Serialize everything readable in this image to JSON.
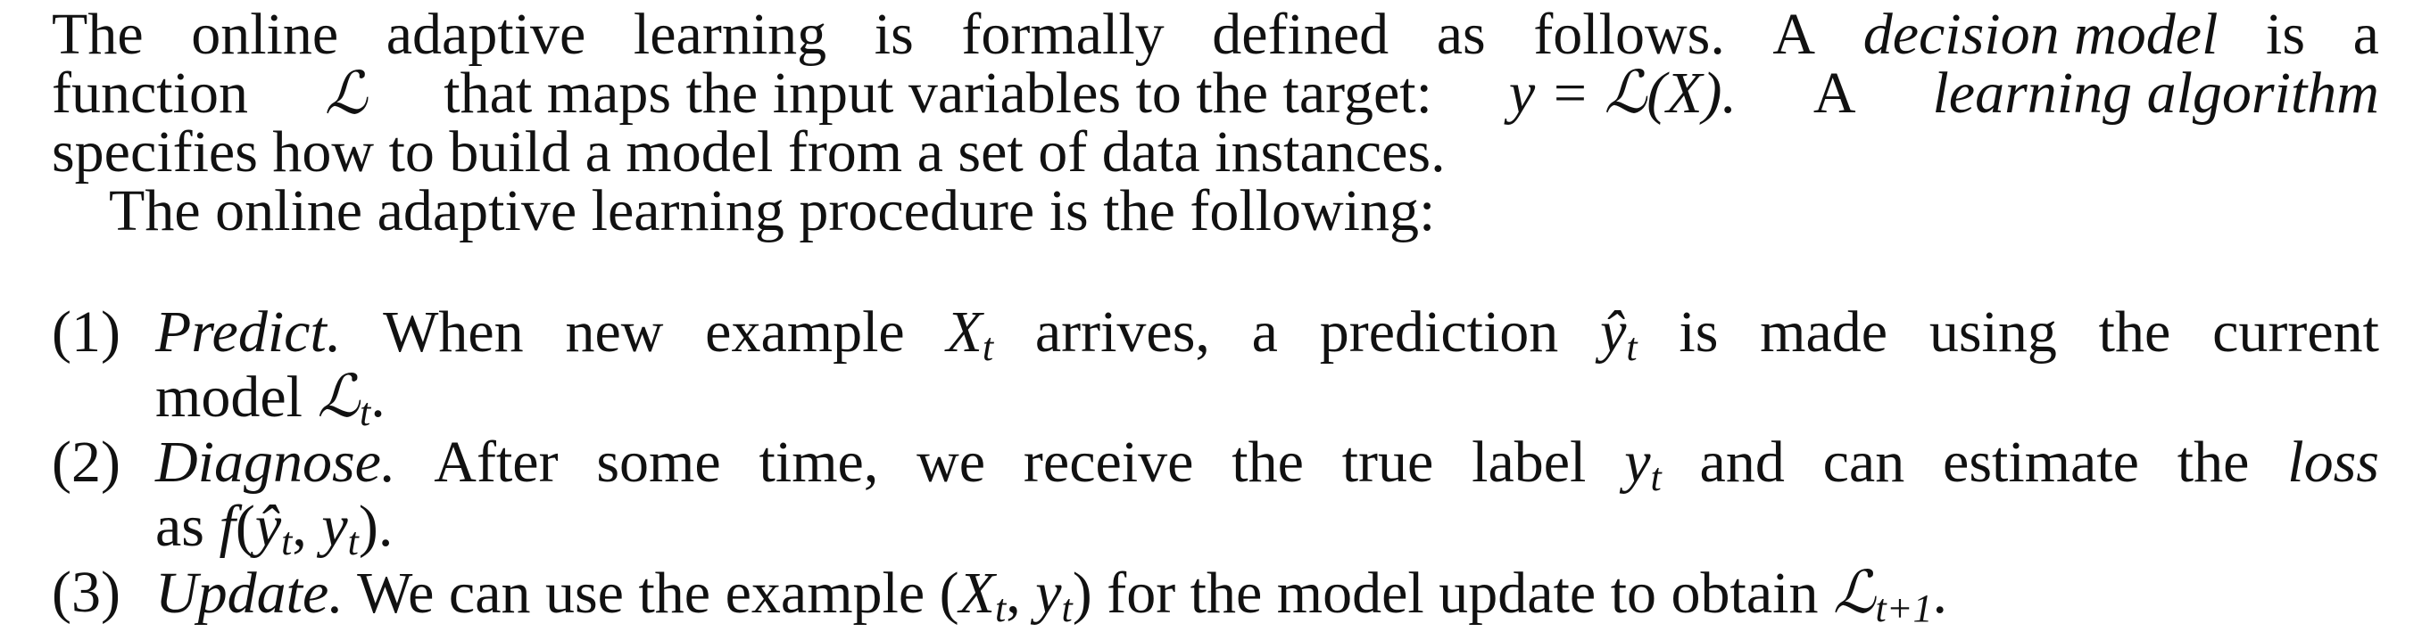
{
  "paragraph1": {
    "line1": [
      "The",
      "online",
      "adaptive",
      "learning",
      "is",
      "formally",
      "defined",
      "as",
      "follows.",
      "A",
      "decision model",
      "is",
      "a"
    ],
    "line1_italic": "decision model",
    "line2_pre": "function",
    "line2_L": "ℒ",
    "line2_mid": "that maps the input variables to the target:",
    "line2_eq": "y = ℒ(X).",
    "line2_A": "A",
    "line2_italic": "learning algorithm",
    "line3": "specifies how to build a model from a set of data instances.",
    "line4": "The online adaptive learning procedure is the following:"
  },
  "items": [
    {
      "num": "(1)",
      "title": "Predict.",
      "line1_words": [
        "When",
        "new",
        "example",
        "X_t",
        "arrives,",
        "a",
        "prediction",
        "ŷ_t",
        "is",
        "made",
        "using",
        "the",
        "current"
      ],
      "line2": "model ℒ_t."
    },
    {
      "num": "(2)",
      "title": "Diagnose.",
      "line1_words": [
        "After",
        "some",
        "time,",
        "we",
        "receive",
        "the",
        "true",
        "label",
        "y_t",
        "and",
        "can",
        "estimate",
        "the",
        "loss"
      ],
      "line2": "as f(ŷ_t, y_t)."
    },
    {
      "num": "(3)",
      "title": "Update.",
      "line1": "We can use the example (X_t, y_t) for the model update to obtain ℒ_{t+1}."
    }
  ]
}
